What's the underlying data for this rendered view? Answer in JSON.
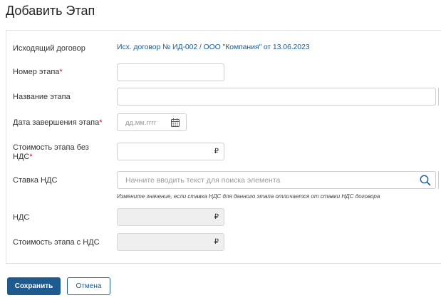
{
  "header": {
    "title": "Добавить Этап"
  },
  "form": {
    "contract_label": "Исходящий договор",
    "contract_link": "Исх. договор № ИД-002 / ООО \"Компания\" от 13.06.2023",
    "stage_number_label": "Номер этапа",
    "stage_name_label": "Название этапа",
    "due_date_label": "Дата завершения этапа",
    "due_date_placeholder": "дд.мм.гггг",
    "cost_no_vat_label_1": "Стоимость этапа без",
    "cost_no_vat_label_2": "НДС",
    "vat_rate_label": "Ставка НДС",
    "vat_rate_placeholder": "Начните вводить текст для поиска элемента",
    "vat_rate_hint": "Измените значение, если ставка НДС для данного этапа отличается от ставки НДС договора",
    "vat_label": "НДС",
    "cost_with_vat_label": "Стоимость этапа с НДС",
    "currency_symbol": "₽",
    "required_mark": "*"
  },
  "actions": {
    "save_label": "Сохранить",
    "cancel_label": "Отмена"
  },
  "colors": {
    "accent": "#1f5a8f",
    "required": "#c8102e"
  }
}
